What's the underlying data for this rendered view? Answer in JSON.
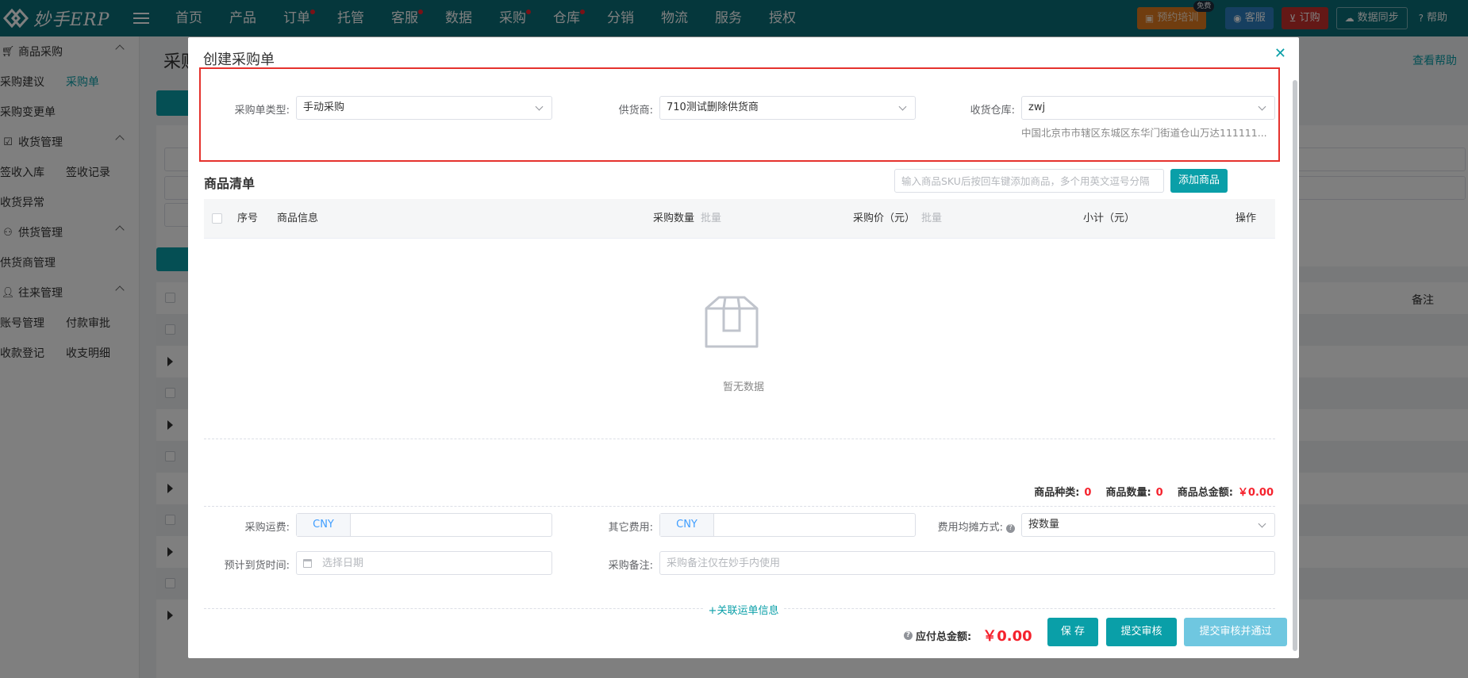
{
  "app": {
    "logo_text": "妙手ERP"
  },
  "nav": {
    "items": [
      {
        "label": "首页",
        "dot": false
      },
      {
        "label": "产品",
        "dot": false
      },
      {
        "label": "订单",
        "dot": true
      },
      {
        "label": "托管",
        "dot": false
      },
      {
        "label": "客服",
        "dot": true
      },
      {
        "label": "数据",
        "dot": false
      },
      {
        "label": "采购",
        "dot": true
      },
      {
        "label": "仓库",
        "dot": true
      },
      {
        "label": "分销",
        "dot": false
      },
      {
        "label": "物流",
        "dot": false
      },
      {
        "label": "服务",
        "dot": false
      },
      {
        "label": "授权",
        "dot": false
      }
    ],
    "right": {
      "training": "预约培训",
      "training_badge": "免费",
      "service": "客服",
      "order": "订购",
      "sync": "数据同步",
      "help": "帮助"
    }
  },
  "sidebar": {
    "groups": [
      {
        "title": "商品采购",
        "icon": "cart-icon",
        "rows": [
          [
            "采购建议",
            "采购单"
          ],
          [
            "采购变更单"
          ]
        ]
      },
      {
        "title": "收货管理",
        "icon": "checkbox-icon",
        "rows": [
          [
            "签收入库",
            "签收记录"
          ],
          [
            "收货异常"
          ]
        ]
      },
      {
        "title": "供货管理",
        "icon": "supplier-icon",
        "rows": [
          [
            "供货商管理"
          ]
        ]
      },
      {
        "title": "往来管理",
        "icon": "person-icon",
        "rows": [
          [
            "账号管理",
            "付款审批"
          ],
          [
            "收款登记",
            "收支明细"
          ]
        ]
      }
    ],
    "sb_labels": {
      "g0": "商品采购",
      "g0r0a": "采购建议",
      "g0r0b": "采购单",
      "g0r1a": "采购变更单",
      "g1": "收货管理",
      "g1r0a": "签收入库",
      "g1r0b": "签收记录",
      "g1r1a": "收货异常",
      "g2": "供货管理",
      "g2r0a": "供货商管理",
      "g3": "往来管理",
      "g3r0a": "账号管理",
      "g3r0b": "付款审批",
      "g3r1a": "收款登记",
      "g3r1b": "收支明细"
    }
  },
  "page": {
    "title": "采购",
    "help_link": "查看帮助",
    "table_note_header": "备注"
  },
  "modal": {
    "title": "创建采购单",
    "form": {
      "order_type_label": "采购单类型:",
      "order_type_value": "手动采购",
      "supplier_label": "供货商:",
      "supplier_value": "710测试删除供货商",
      "warehouse_label": "收货仓库:",
      "warehouse_value": "zwj",
      "warehouse_address": "中国北京市市辖区东城区东华门街道仓山万达111111..."
    },
    "goods": {
      "section_title": "商品清单",
      "sku_placeholder": "输入商品SKU后按回车键添加商品，多个用英文逗号分隔",
      "add_button": "添加商品",
      "columns": {
        "index": "序号",
        "info": "商品信息",
        "qty": "采购数量",
        "qty_sub": "批量",
        "price": "采购价（元）",
        "price_sub": "批量",
        "subtotal": "小计（元）",
        "action": "操作"
      },
      "empty_text": "暂无数据"
    },
    "summary": {
      "kinds_label": "商品种类:",
      "kinds_value": "0",
      "count_label": "商品数量:",
      "count_value": "0",
      "amount_label": "商品总金额:",
      "amount_value": "￥0.00"
    },
    "fees": {
      "freight_label": "采购运费:",
      "freight_currency": "CNY",
      "other_label": "其它费用:",
      "other_currency": "CNY",
      "allocation_label": "费用均摊方式:",
      "allocation_value": "按数量",
      "eta_label": "预计到货时间:",
      "eta_placeholder": "选择日期",
      "remark_label": "采购备注:",
      "remark_placeholder": "采购备注仅在妙手内使用"
    },
    "link_waybill": "+关联运单信息",
    "footer": {
      "total_label": "应付总金额:",
      "total_value": "￥0.00",
      "save": "保 存",
      "submit": "提交审核",
      "submit_approve": "提交审核并通过"
    }
  },
  "colors": {
    "topbar": "#0b6e78",
    "accent": "#0a9fa8",
    "highlight_box": "#e5322d",
    "amount": "#f5222d"
  }
}
